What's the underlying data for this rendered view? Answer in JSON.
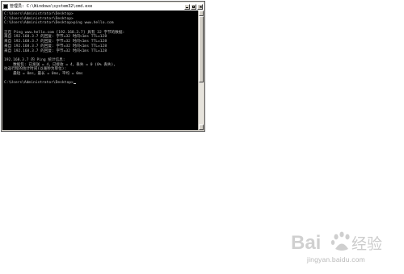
{
  "window": {
    "title": "管理员: C:\\Windows\\system32\\cmd.exe"
  },
  "console": {
    "lines": [
      "C:\\Users\\Administrator\\Desktop>",
      "C:\\Users\\Administrator\\Desktop>",
      "C:\\Users\\Administrator\\Desktop>ping www.hello.com",
      "",
      "正在 Ping www.hello.com [192.168.3.7] 具有 32 字节的数据:",
      "来自 192.168.3.7 的回复: 字节=32 时间<1ms TTL=128",
      "来自 192.168.3.7 的回复: 字节=32 时间<1ms TTL=128",
      "来自 192.168.3.7 的回复: 字节=32 时间<1ms TTL=128",
      "来自 192.168.3.7 的回复: 字节=32 时间<1ms TTL=128",
      "",
      "192.168.3.7 的 Ping 统计信息:",
      "    数据包: 已发送 = 4，已接收 = 4，丢失 = 0 (0% 丢失)，",
      "往返行程的估计时间(以毫秒为单位):",
      "    最短 = 0ms，最长 = 0ms，平均 = 0ms",
      "",
      "C:\\Users\\Administrator\\Desktop>"
    ]
  },
  "watermark": {
    "logo_text": "Baidu经验",
    "url": "jingyan.baidu.com"
  },
  "colors": {
    "console_background": "#000000",
    "console_text": "#c0c0c0",
    "watermark": "#b9b9b9"
  }
}
